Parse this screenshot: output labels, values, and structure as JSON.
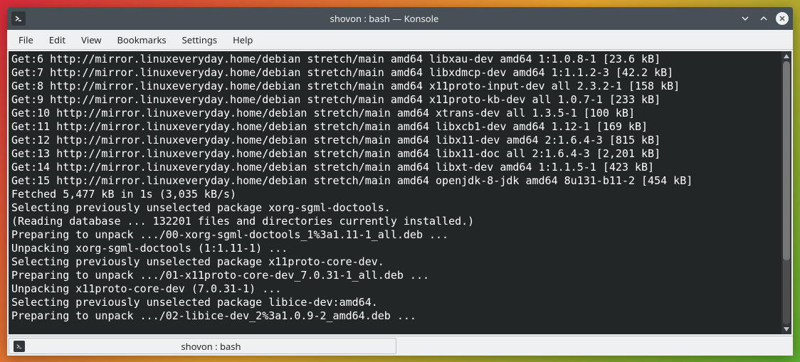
{
  "window": {
    "title": "shovon : bash — Konsole"
  },
  "menu": {
    "file": "File",
    "edit": "Edit",
    "view": "View",
    "bookmarks": "Bookmarks",
    "settings": "Settings",
    "help": "Help"
  },
  "tab": {
    "label": "shovon : bash"
  },
  "terminal": {
    "lines": [
      "Get:6 http://mirror.linuxeveryday.home/debian stretch/main amd64 libxau-dev amd64 1:1.0.8-1 [23.6 kB]",
      "Get:7 http://mirror.linuxeveryday.home/debian stretch/main amd64 libxdmcp-dev amd64 1:1.1.2-3 [42.2 kB]",
      "Get:8 http://mirror.linuxeveryday.home/debian stretch/main amd64 x11proto-input-dev all 2.3.2-1 [158 kB]",
      "Get:9 http://mirror.linuxeveryday.home/debian stretch/main amd64 x11proto-kb-dev all 1.0.7-1 [233 kB]",
      "Get:10 http://mirror.linuxeveryday.home/debian stretch/main amd64 xtrans-dev all 1.3.5-1 [100 kB]",
      "Get:11 http://mirror.linuxeveryday.home/debian stretch/main amd64 libxcb1-dev amd64 1.12-1 [169 kB]",
      "Get:12 http://mirror.linuxeveryday.home/debian stretch/main amd64 libx11-dev amd64 2:1.6.4-3 [815 kB]",
      "Get:13 http://mirror.linuxeveryday.home/debian stretch/main amd64 libx11-doc all 2:1.6.4-3 [2,201 kB]",
      "Get:14 http://mirror.linuxeveryday.home/debian stretch/main amd64 libxt-dev amd64 1:1.1.5-1 [423 kB]",
      "Get:15 http://mirror.linuxeveryday.home/debian stretch/main amd64 openjdk-8-jdk amd64 8u131-b11-2 [454 kB]",
      "Fetched 5,477 kB in 1s (3,035 kB/s)",
      "Selecting previously unselected package xorg-sgml-doctools.",
      "(Reading database ... 132201 files and directories currently installed.)",
      "Preparing to unpack .../00-xorg-sgml-doctools_1%3a1.11-1_all.deb ...",
      "Unpacking xorg-sgml-doctools (1:1.11-1) ...",
      "Selecting previously unselected package x11proto-core-dev.",
      "Preparing to unpack .../01-x11proto-core-dev_7.0.31-1_all.deb ...",
      "Unpacking x11proto-core-dev (7.0.31-1) ...",
      "Selecting previously unselected package libice-dev:amd64.",
      "Preparing to unpack .../02-libice-dev_2%3a1.0.9-2_amd64.deb ..."
    ]
  }
}
